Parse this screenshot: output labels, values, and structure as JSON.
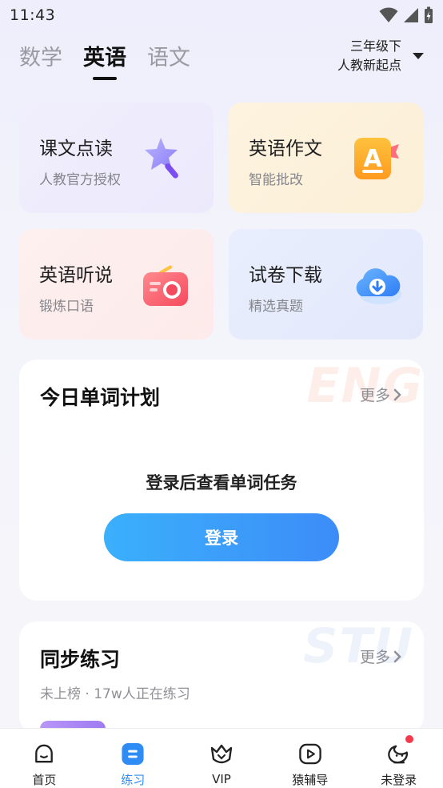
{
  "status_bar": {
    "time": "11:43"
  },
  "subject_tabs": [
    {
      "label": "数学",
      "active": false
    },
    {
      "label": "英语",
      "active": true
    },
    {
      "label": "语文",
      "active": false
    }
  ],
  "grade_selector": {
    "line1": "三年级下",
    "line2": "人教新起点"
  },
  "feature_cards": [
    {
      "title": "课文点读",
      "subtitle": "人教官方授权",
      "icon": "magic-wand-star-icon"
    },
    {
      "title": "英语作文",
      "subtitle": "智能批改",
      "icon": "letter-a-book-icon"
    },
    {
      "title": "英语听说",
      "subtitle": "锻炼口语",
      "icon": "radio-icon"
    },
    {
      "title": "试卷下载",
      "subtitle": "精选真题",
      "icon": "cloud-download-icon"
    }
  ],
  "word_plan": {
    "title": "今日单词计划",
    "more_label": "更多",
    "watermark": "ENG",
    "login_hint": "登录后查看单词任务",
    "login_button": "登录"
  },
  "sync_practice": {
    "title": "同步练习",
    "more_label": "更多",
    "watermark": "STU",
    "meta": "未上榜 · 17w人正在练习"
  },
  "bottom_nav": [
    {
      "label": "首页",
      "icon": "home-face-icon",
      "active": false
    },
    {
      "label": "练习",
      "icon": "practice-icon",
      "active": true
    },
    {
      "label": "VIP",
      "icon": "vip-crown-icon",
      "active": false
    },
    {
      "label": "猿辅导",
      "icon": "play-video-icon",
      "active": false
    },
    {
      "label": "未登录",
      "icon": "avatar-icon",
      "active": false
    }
  ],
  "colors": {
    "accent": "#2f8cf5",
    "button_gradient_start": "#3bb0fb",
    "button_gradient_end": "#3c8cf8",
    "card_purple": "#efedfc",
    "card_yellow": "#fdf2dd",
    "card_pink": "#fdeeee",
    "card_blue": "#e6ecfc",
    "badge_red": "#f5384b"
  }
}
